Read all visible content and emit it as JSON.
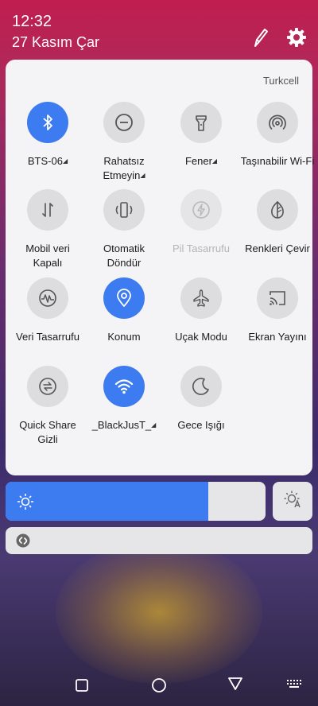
{
  "status_bar": {
    "time": "12:32",
    "date": "27 Kasım Çar"
  },
  "panel": {
    "carrier": "Turkcell"
  },
  "tiles": [
    {
      "label": "BTS-06",
      "state": "on",
      "icon": "bluetooth-icon",
      "caret": "◢"
    },
    {
      "label": "Rahatsız Etmeyin",
      "state": "off",
      "icon": "do-not-disturb-icon",
      "caret": "◢"
    },
    {
      "label": "Fener",
      "state": "off",
      "icon": "flashlight-icon",
      "caret": "◢"
    },
    {
      "label": "Taşınabilir Wi-Fi",
      "state": "off",
      "icon": "hotspot-icon"
    },
    {
      "label": "Mobil veri Kapalı",
      "state": "off",
      "icon": "mobile-data-icon"
    },
    {
      "label": "Otomatik Döndür",
      "state": "off",
      "icon": "auto-rotate-icon"
    },
    {
      "label": "Pil Tasarrufu",
      "state": "disabled",
      "icon": "battery-saver-icon"
    },
    {
      "label": "Renkleri Çevir",
      "state": "off",
      "icon": "invert-colors-icon"
    },
    {
      "label": "Veri Tasarrufu",
      "state": "off",
      "icon": "data-saver-icon"
    },
    {
      "label": "Konum",
      "state": "on",
      "icon": "location-icon"
    },
    {
      "label": "Uçak Modu",
      "state": "off",
      "icon": "airplane-icon"
    },
    {
      "label": "Ekran Yayını",
      "state": "off",
      "icon": "cast-icon"
    },
    {
      "label": "Quick Share Gizli",
      "state": "off",
      "icon": "quick-share-icon"
    },
    {
      "label": "_BlackJusT_",
      "state": "on",
      "icon": "wifi-icon",
      "caret": "◢"
    },
    {
      "label": "Gece Işığı",
      "state": "off",
      "icon": "night-light-icon"
    }
  ],
  "brightness": {
    "level": 0.78
  },
  "colors": {
    "accent": "#3c7cf0",
    "tile_off": "#dddcde",
    "panel": "#f4f3f5"
  }
}
